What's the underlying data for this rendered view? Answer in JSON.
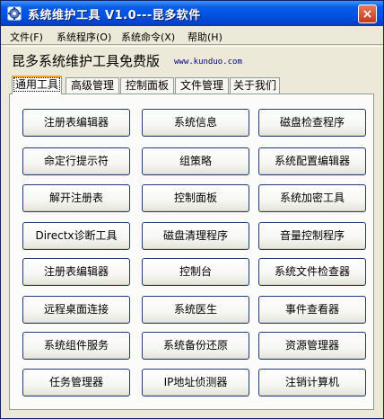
{
  "window": {
    "title": "系统维护工具 V1.0---昆多软件",
    "close_symbol": "×"
  },
  "menu": [
    {
      "label": "文件(F)"
    },
    {
      "label": "系统程序(O)"
    },
    {
      "label": "系统命令(X)"
    },
    {
      "label": "帮助(H)"
    }
  ],
  "header": {
    "title": "昆多系统维护工具免费版",
    "url": "www.kunduo.com"
  },
  "tabs": [
    {
      "label": "通用工具",
      "active": true
    },
    {
      "label": "高级管理"
    },
    {
      "label": "控制面板"
    },
    {
      "label": "文件管理"
    },
    {
      "label": "关于我们"
    }
  ],
  "buttons": [
    [
      "注册表编辑器",
      "系统信息",
      "磁盘检查程序"
    ],
    [
      "命定行提示符",
      "组策略",
      "系统配置编辑器"
    ],
    [
      "解开注册表",
      "控制面板",
      "系统加密工具"
    ],
    [
      "Directx诊断工具",
      "磁盘清理程序",
      "音量控制程序"
    ],
    [
      "注册表编辑器",
      "控制台",
      "系统文件检查器"
    ],
    [
      "远程桌面连接",
      "系统医生",
      "事件查看器"
    ],
    [
      "系统组件服务",
      "系统备份还原",
      "资源管理器"
    ],
    [
      "任务管理器",
      "IP地址侦测器",
      "注销计算机"
    ]
  ],
  "colors": {
    "titlebar": "#0054e3",
    "face": "#ece9d8",
    "tab_active_accent": "#f4a823"
  },
  "icons": {
    "app": "gear-icon",
    "close": "close-icon"
  }
}
